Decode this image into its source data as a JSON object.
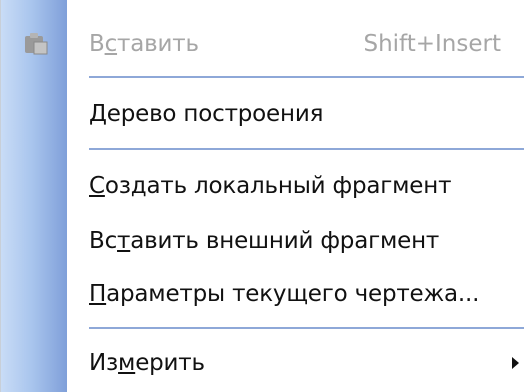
{
  "menu": {
    "items": [
      {
        "label": "Вставить",
        "mnemonic_index": 1,
        "shortcut": "Shift+Insert",
        "enabled": false,
        "icon": "paste-icon"
      },
      {
        "label": "Дерево построения",
        "mnemonic_index": 0,
        "enabled": true
      },
      {
        "label": "Создать локальный фрагмент",
        "mnemonic_index": 0,
        "enabled": true
      },
      {
        "label": "Вставить внешний фрагмент",
        "mnemonic_index": 2,
        "enabled": true
      },
      {
        "label": "Параметры текущего чертежа...",
        "mnemonic_index": 0,
        "enabled": true
      },
      {
        "label": "Измерить",
        "mnemonic_index": 2,
        "enabled": true,
        "submenu": true,
        "icon": "submenu-arrow-icon"
      }
    ]
  },
  "colors": {
    "gutter_light": "#c9dcf6",
    "gutter_dark": "#7f9fd9",
    "separator": "#8ea8d8",
    "disabled_text": "#a6a6a6"
  }
}
